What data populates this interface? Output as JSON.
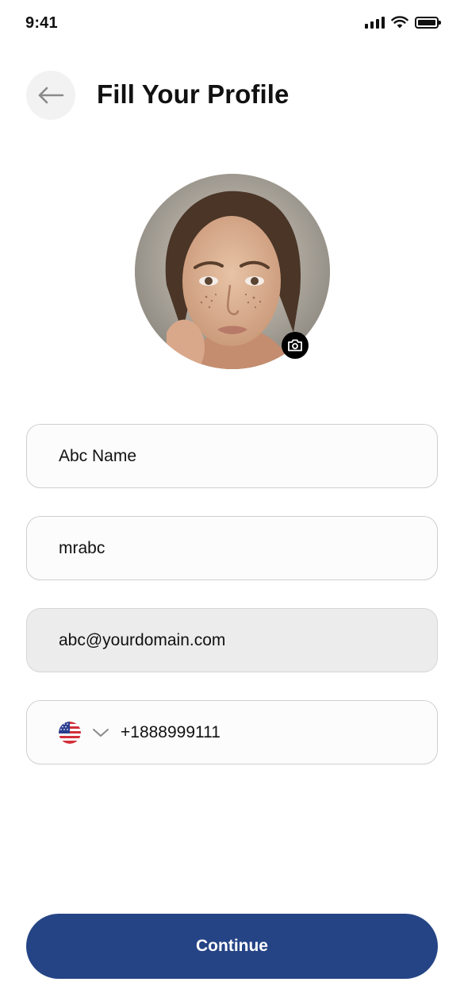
{
  "status_bar": {
    "time": "9:41",
    "icons": [
      "signal-icon",
      "wifi-icon",
      "battery-icon"
    ]
  },
  "header": {
    "back_icon": "arrow-left-icon",
    "title": "Fill Your Profile"
  },
  "avatar": {
    "edit_icon": "camera-icon"
  },
  "form": {
    "full_name": {
      "value": "Abc Name"
    },
    "username": {
      "value": "mrabc"
    },
    "email": {
      "value": "abc@yourdomain.com",
      "disabled": true
    },
    "phone": {
      "country_flag_icon": "us-flag-icon",
      "dropdown_icon": "chevron-down-icon",
      "value": "+1888999111"
    }
  },
  "actions": {
    "continue_label": "Continue"
  },
  "colors": {
    "primary": "#254485",
    "back_button_bg": "#f2f2f2",
    "field_border": "#cfcfcf",
    "disabled_field_bg": "#ececec"
  }
}
